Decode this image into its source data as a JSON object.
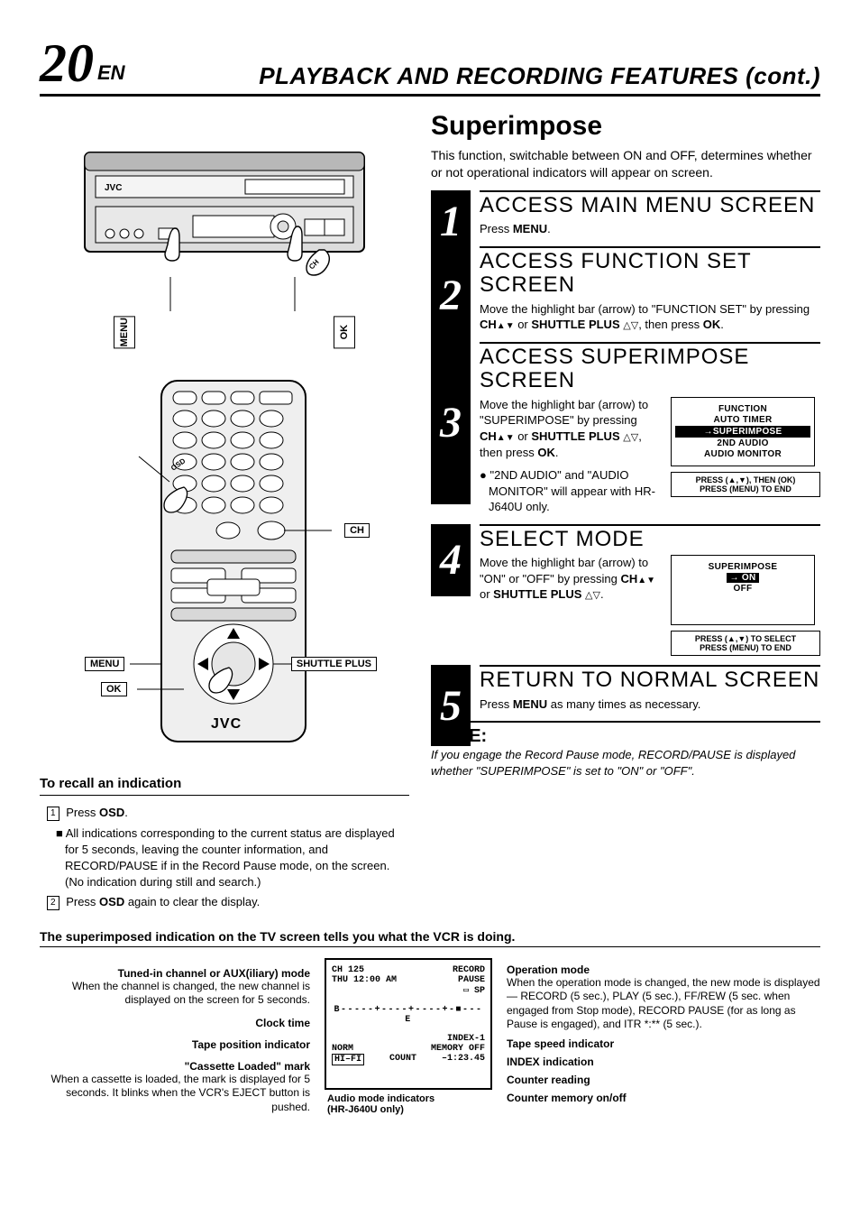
{
  "header": {
    "page_number": "20",
    "lang": "EN",
    "title": "PLAYBACK AND RECORDING FEATURES (cont.)"
  },
  "superimpose": {
    "heading": "Superimpose",
    "intro": "This function, switchable between ON and OFF, determines whether or not operational indicators will appear on screen."
  },
  "steps": [
    {
      "num": "1",
      "title": "ACCESS MAIN MENU SCREEN",
      "body_plain": "Press MENU.",
      "body_bold": "MENU"
    },
    {
      "num": "2",
      "title": "ACCESS FUNCTION SET SCREEN",
      "body_pre": "Move the highlight bar (arrow) to \"FUNCTION SET\" by pressing ",
      "body_mid": " or ",
      "body_post": ", then press ",
      "ch_label": "CH",
      "shuttle_label": "SHUTTLE PLUS",
      "ok_label": "OK"
    },
    {
      "num": "3",
      "title": "ACCESS SUPERIMPOSE SCREEN",
      "body_pre": "Move the highlight bar (arrow) to \"SUPERIMPOSE\" by pressing ",
      "body_mid": " or ",
      "body_post": ", then press ",
      "ch_label": "CH",
      "shuttle_label": "SHUTTLE PLUS",
      "ok_label": "OK",
      "bullet": "\"2ND AUDIO\" and \"AUDIO MONITOR\" will appear with HR-J640U only.",
      "onscreen_lines": [
        "FUNCTION",
        "AUTO TIMER",
        "→SUPERIMPOSE",
        "2ND AUDIO",
        "AUDIO MONITOR"
      ],
      "onscreen_foot": "PRESS (▲,▼), THEN (OK)\nPRESS (MENU) TO END"
    },
    {
      "num": "4",
      "title": "SELECT MODE",
      "body_pre": "Move the highlight bar (arrow) to \"ON\" or \"OFF\" by pressing ",
      "body_mid": " or ",
      "body_post": ".",
      "ch_label": "CH",
      "shuttle_label": "SHUTTLE PLUS",
      "onscreen_lines": [
        "SUPERIMPOSE",
        "",
        "→ ON",
        "OFF"
      ],
      "onscreen_foot": "PRESS (▲,▼) TO SELECT\nPRESS (MENU) TO END"
    },
    {
      "num": "5",
      "title": "RETURN TO NORMAL SCREEN",
      "body_pre": "Press ",
      "body_bold": "MENU",
      "body_post": " as many times as necessary."
    }
  ],
  "note": {
    "title": "NOTE:",
    "body": "If you engage the Record Pause mode, RECORD/PAUSE is displayed whether \"SUPERIMPOSE\" is set to \"ON\" or \"OFF\"."
  },
  "recall": {
    "heading": "To recall an indication",
    "line1_pre": "Press ",
    "line1_bold": "OSD",
    "line1_post": ".",
    "bullet": "All indications corresponding to the current status are displayed for 5 seconds, leaving the counter information, and RECORD/PAUSE if in the Record Pause mode, on the screen. (No indication during still and search.)",
    "line2_pre": "Press ",
    "line2_bold": "OSD",
    "line2_post": " again to clear the display.",
    "num1": "1",
    "num2": "2"
  },
  "vcr_labels": {
    "menu": "MENU",
    "ch": "CH",
    "ok": "OK",
    "brand": "JVC"
  },
  "remote_labels": {
    "osd": "OSD",
    "ch": "CH",
    "menu": "MENU",
    "shuttle": "SHUTTLE PLUS",
    "ok": "OK",
    "brand": "JVC"
  },
  "tv": {
    "heading": "The superimposed indication on the TV screen tells you what the VCR is doing.",
    "left_items": [
      {
        "label": "Tuned-in channel or AUX(iliary) mode",
        "desc": "When the channel is changed, the new channel is displayed on the screen for 5 seconds."
      },
      {
        "label": "Clock time",
        "desc": ""
      },
      {
        "label": "Tape position indicator",
        "desc": ""
      },
      {
        "label": "\"Cassette Loaded\" mark",
        "desc": "When a cassette is loaded, the mark is displayed for 5 seconds. It blinks when the VCR's EJECT button is pushed."
      }
    ],
    "right_items": [
      {
        "label": "Operation mode",
        "desc": "When the operation mode is changed, the new mode is displayed — RECORD (5 sec.), PLAY (5 sec.), FF/REW (5 sec. when engaged from Stop mode), RECORD PAUSE (for as long as Pause is engaged), and ITR *:** (5 sec.)."
      },
      {
        "label": "Tape speed indicator",
        "desc": ""
      },
      {
        "label": "INDEX indication",
        "desc": ""
      },
      {
        "label": "Counter reading",
        "desc": ""
      },
      {
        "label": "Counter memory on/off",
        "desc": ""
      }
    ],
    "center_foot_left": "Audio mode indicators\n(HR-J640U only)",
    "screen": {
      "row1_left": "CH  125",
      "row1_right": "RECORD",
      "row2_left": "THU 12:00 AM",
      "row2_right": "PAUSE",
      "row3_right": "▭ SP",
      "bar": "B-----+----+----+-■---E",
      "row5_right": "INDEX-1",
      "row6_left": "NORM",
      "row6_right": "MEMORY OFF",
      "row7_left": "HI–FI",
      "row7_mid": "COUNT",
      "row7_right": "–1:23.45"
    }
  }
}
